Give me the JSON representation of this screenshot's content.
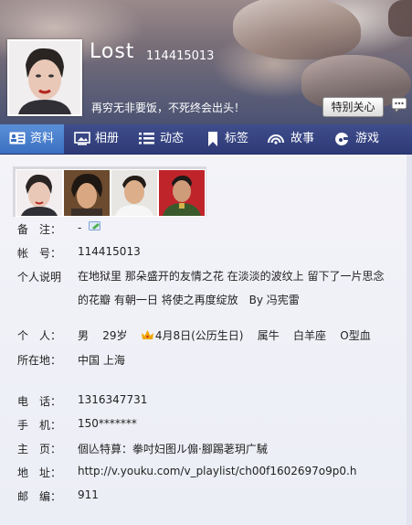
{
  "profile": {
    "nickname": "Lost",
    "qq_number": "114415013",
    "signature": "再穷无非要饭，不死终会出头！",
    "special_care_label": "特别关心"
  },
  "tabs": [
    {
      "label": "资料",
      "icon": "profile-card-icon",
      "active": true
    },
    {
      "label": "相册",
      "icon": "photo-album-icon",
      "active": false
    },
    {
      "label": "动态",
      "icon": "feed-list-icon",
      "active": false
    },
    {
      "label": "标签",
      "icon": "bookmark-tag-icon",
      "active": false
    },
    {
      "label": "故事",
      "icon": "story-wifi-icon",
      "active": false
    },
    {
      "label": "游戏",
      "icon": "game-icon",
      "active": false
    }
  ],
  "info": {
    "remark_label": "备　注：",
    "remark_value": "-",
    "account_label": "帐　号：",
    "account_value": "114415013",
    "bio_label": "个人说明",
    "bio_line1": "在地狱里 那朵盛开的友情之花 在淡淡的波纹上 留下了一片思念",
    "bio_line2": "的花瓣 有朝一日 将使之再度绽放　By 冯宪雷",
    "personal_label": "个　人：",
    "gender": "男",
    "age": "29岁",
    "birthday": "4月8日(公历生日)",
    "zodiac": "属牛",
    "constellation": "白羊座",
    "blood_type": "O型血",
    "location_label": "所在地：",
    "location_value": "中国 上海",
    "phone_label": "电　话：",
    "phone_value": "1316347731",
    "mobile_label": "手　机：",
    "mobile_value": "150*******",
    "homepage_label": "主　页：",
    "homepage_value": "個亾特萛：拳吋妇图ル傓·腳踢荖玥广駴",
    "address_label": "地　址：",
    "address_value": "http://v.youku.com/v_playlist/ch00f1602697o9p0.h",
    "postcode_label": "邮　编：",
    "postcode_value": "911"
  },
  "colors": {
    "tab_bar": "#2d3a76",
    "tab_active": "#4a7fd0",
    "crown": "#f0a800",
    "remark_icon": "#4caf50"
  }
}
